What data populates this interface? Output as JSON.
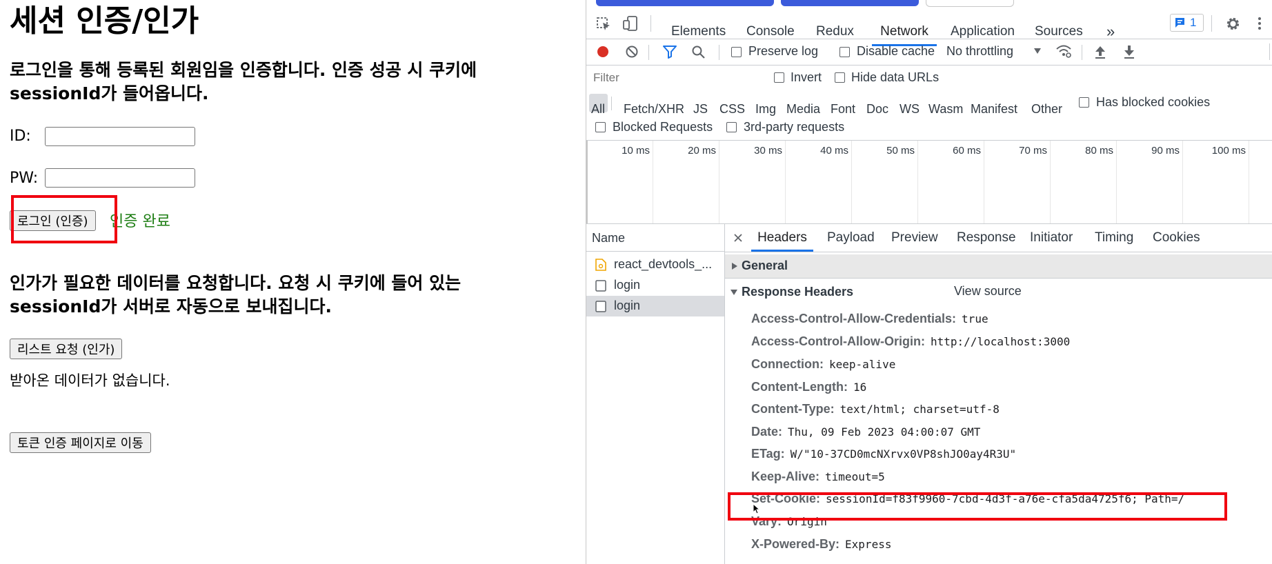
{
  "page": {
    "title": "세션 인증/인가",
    "login_desc": "로그인을 통해 등록된 회원임을 인증합니다. 인증 성공 시 쿠키에 sessionId가 들어옵니다.",
    "id_label": "ID:",
    "pw_label": "PW:",
    "login_button": "로그인 (인증)",
    "auth_status": "인증 완료",
    "authz_desc": "인가가 필요한 데이터를 요청합니다. 요청 시 쿠키에 들어 있는 sessionId가 서버로 자동으로 보내집니다.",
    "list_button": "리스트 요청 (인가)",
    "no_data": "받아온 데이터가 없습니다.",
    "token_button": "토큰 인증 페이지로 이동"
  },
  "devtools": {
    "tabs": [
      "Elements",
      "Console",
      "Redux",
      "Network",
      "Application",
      "Sources"
    ],
    "active_tab": "Network",
    "more": "»",
    "issues_count": "1",
    "toolbar": {
      "preserve_log": "Preserve log",
      "disable_cache": "Disable cache",
      "throttling": "No throttling"
    },
    "filter": {
      "placeholder": "Filter",
      "invert": "Invert",
      "hide_data_urls": "Hide data URLs",
      "types": [
        "All",
        "Fetch/XHR",
        "JS",
        "CSS",
        "Img",
        "Media",
        "Font",
        "Doc",
        "WS",
        "Wasm",
        "Manifest",
        "Other"
      ],
      "has_blocked_cookies": "Has blocked cookies",
      "blocked_requests": "Blocked Requests",
      "third_party": "3rd-party requests"
    },
    "timeline_ticks": [
      "10 ms",
      "20 ms",
      "30 ms",
      "40 ms",
      "50 ms",
      "60 ms",
      "70 ms",
      "80 ms",
      "90 ms",
      "100 ms"
    ],
    "name_header": "Name",
    "requests": [
      "react_devtools_...",
      "login",
      "login"
    ],
    "detail_tabs": [
      "Headers",
      "Payload",
      "Preview",
      "Response",
      "Initiator",
      "Timing",
      "Cookies"
    ],
    "general": "General",
    "response_headers_title": "Response Headers",
    "view_source": "View source",
    "headers": [
      {
        "name": "Access-Control-Allow-Credentials:",
        "value": "true"
      },
      {
        "name": "Access-Control-Allow-Origin:",
        "value": "http://localhost:3000"
      },
      {
        "name": "Connection:",
        "value": "keep-alive"
      },
      {
        "name": "Content-Length:",
        "value": "16"
      },
      {
        "name": "Content-Type:",
        "value": "text/html; charset=utf-8"
      },
      {
        "name": "Date:",
        "value": "Thu, 09 Feb 2023 04:00:07 GMT"
      },
      {
        "name": "ETag:",
        "value": "W/\"10-37CD0mcNXrvx0VP8shJO0ay4R3U\""
      },
      {
        "name": "Keep-Alive:",
        "value": "timeout=5"
      },
      {
        "name": "Set-Cookie:",
        "value": "sessionId=f83f9960-7cbd-4d3f-a76e-cfa5da4725f6; Path=/"
      },
      {
        "name": "Vary:",
        "value": "Origin"
      },
      {
        "name": "X-Powered-By:",
        "value": "Express"
      }
    ]
  },
  "colors": {
    "highlight_red": "#f0000f",
    "accent_blue": "#1a73e8",
    "success_green": "#1e7e14",
    "record_red": "#d93025"
  }
}
